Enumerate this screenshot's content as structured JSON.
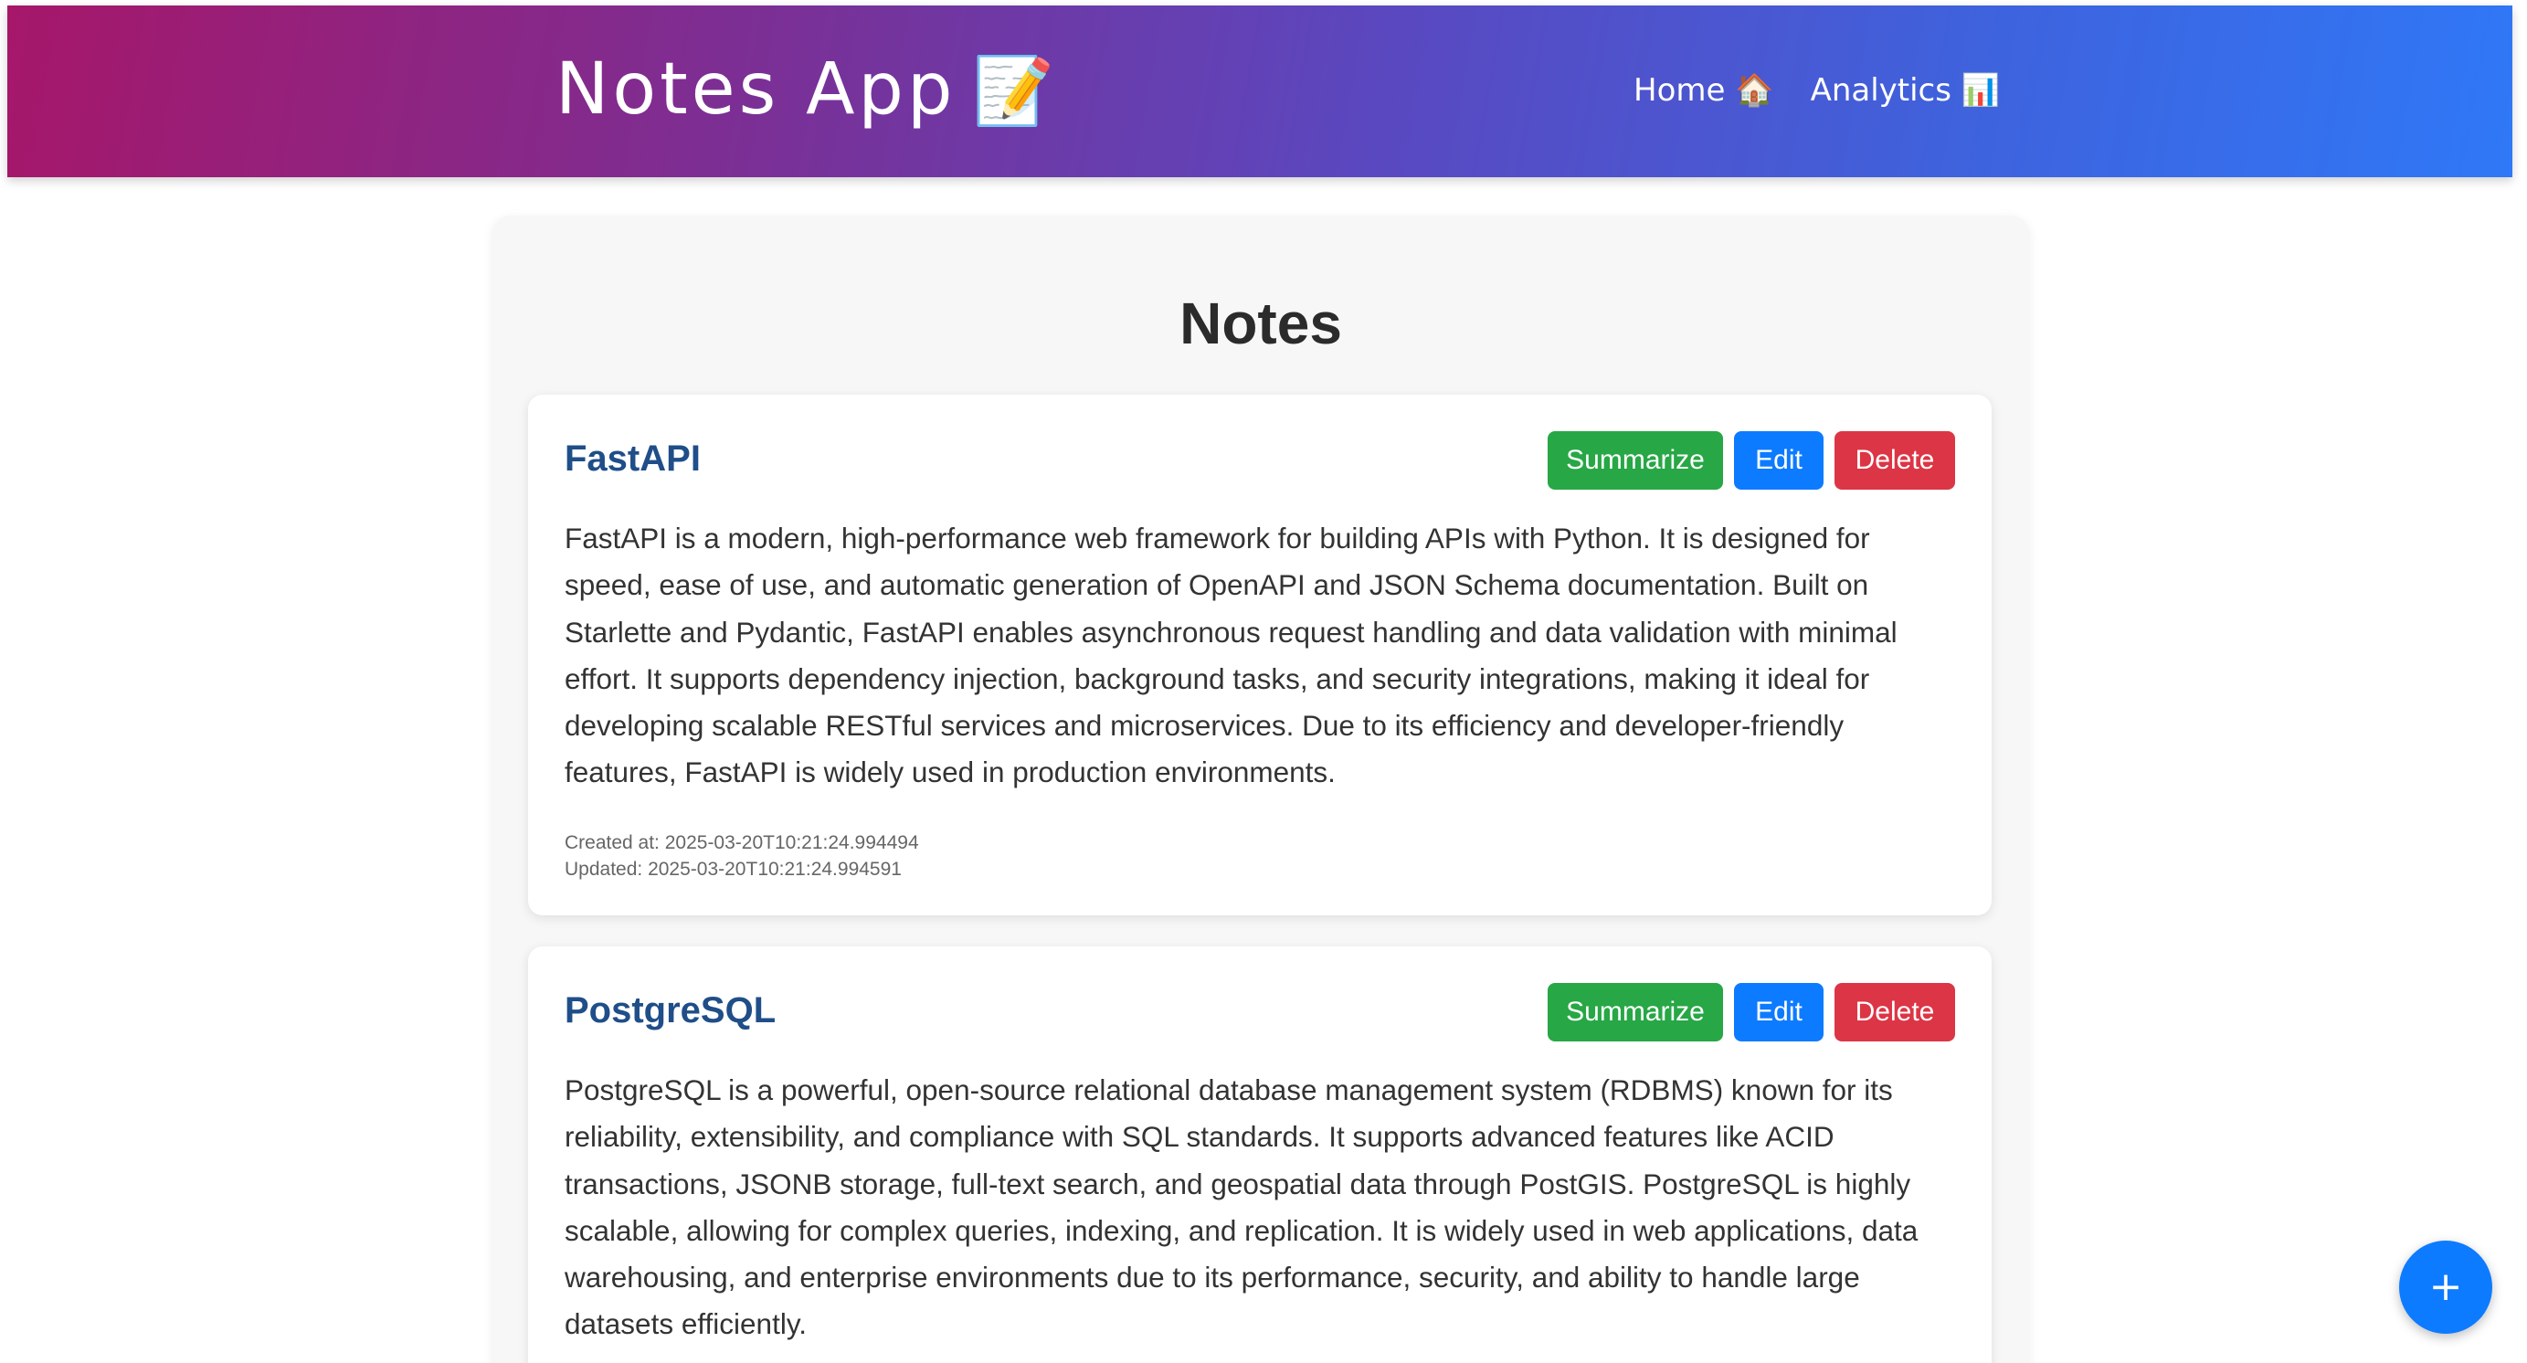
{
  "header": {
    "brand_text": "Notes App",
    "brand_emoji": "📝",
    "nav": [
      {
        "label": "Home 🏠"
      },
      {
        "label": "Analytics 📊"
      }
    ]
  },
  "main": {
    "title": "Notes",
    "notes": [
      {
        "title": "FastAPI",
        "content": "FastAPI is a modern, high-performance web framework for building APIs with Python. It is designed for speed, ease of use, and automatic generation of OpenAPI and JSON Schema documentation. Built on Starlette and Pydantic, FastAPI enables asynchronous request handling and data validation with minimal effort. It supports dependency injection, background tasks, and security integrations, making it ideal for developing scalable RESTful services and microservices. Due to its efficiency and developer-friendly features, FastAPI is widely used in production environments.",
        "created": "Created at: 2025-03-20T10:21:24.994494",
        "updated": "Updated: 2025-03-20T10:21:24.994591"
      },
      {
        "title": "PostgreSQL",
        "content": "PostgreSQL is a powerful, open-source relational database management system (RDBMS) known for its reliability, extensibility, and compliance with SQL standards. It supports advanced features like ACID transactions, JSONB storage, full-text search, and geospatial data through PostGIS. PostgreSQL is highly scalable, allowing for complex queries, indexing, and replication. It is widely used in web applications, data warehousing, and enterprise environments due to its performance, security, and ability to handle large datasets efficiently."
      }
    ],
    "actions": {
      "summarize": "Summarize",
      "edit": "Edit",
      "delete": "Delete"
    }
  },
  "fab": {
    "label": "+"
  },
  "colors": {
    "summarize": "#27a745",
    "edit": "#0d7bff",
    "delete": "#dc3545",
    "note_title": "#1f4e89",
    "header_gradient_start": "#a6176a",
    "header_gradient_end": "#2f78f7"
  }
}
